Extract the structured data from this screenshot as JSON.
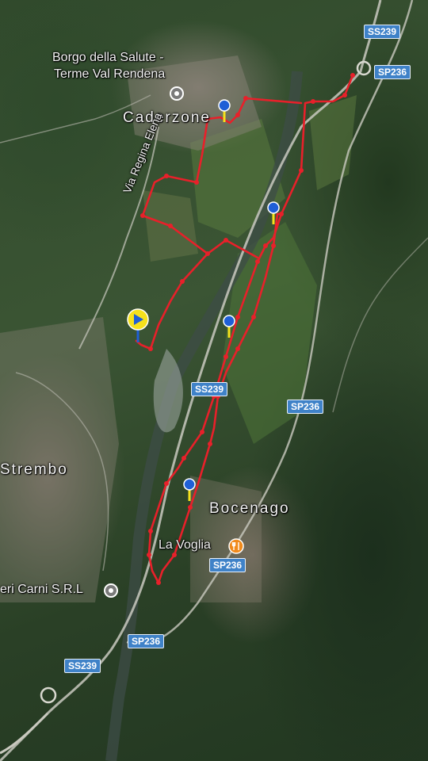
{
  "colors": {
    "route": "#e8202a",
    "pin_blue": "#1f5fd6",
    "pin_yellow": "#f5e11c",
    "road_badge": "#3f82c8"
  },
  "labels": {
    "borgo_line1": "Borgo della Salute -",
    "borgo_line2": "Terme Val Rendena",
    "caderzone": "Caderzone",
    "strembo": "Strembo",
    "bocenago": "Bocenago",
    "la_voglia": "La Voglia",
    "carni": "eri Carni S.R.L",
    "street": "Via Regina Elena"
  },
  "roads": {
    "ss239_top": "SS239",
    "sp236_top": "SP236",
    "ss239_mid": "SS239",
    "sp236_mid": "SP236",
    "sp236_voglia": "SP236",
    "sp236_bottom": "SP236",
    "ss239_bottom": "SS239"
  },
  "icons": {
    "start_marker": "play-arrow-icon",
    "waypoint": "map-pin-icon",
    "restaurant": "fork-knife-icon",
    "place": "place-circle-icon"
  }
}
